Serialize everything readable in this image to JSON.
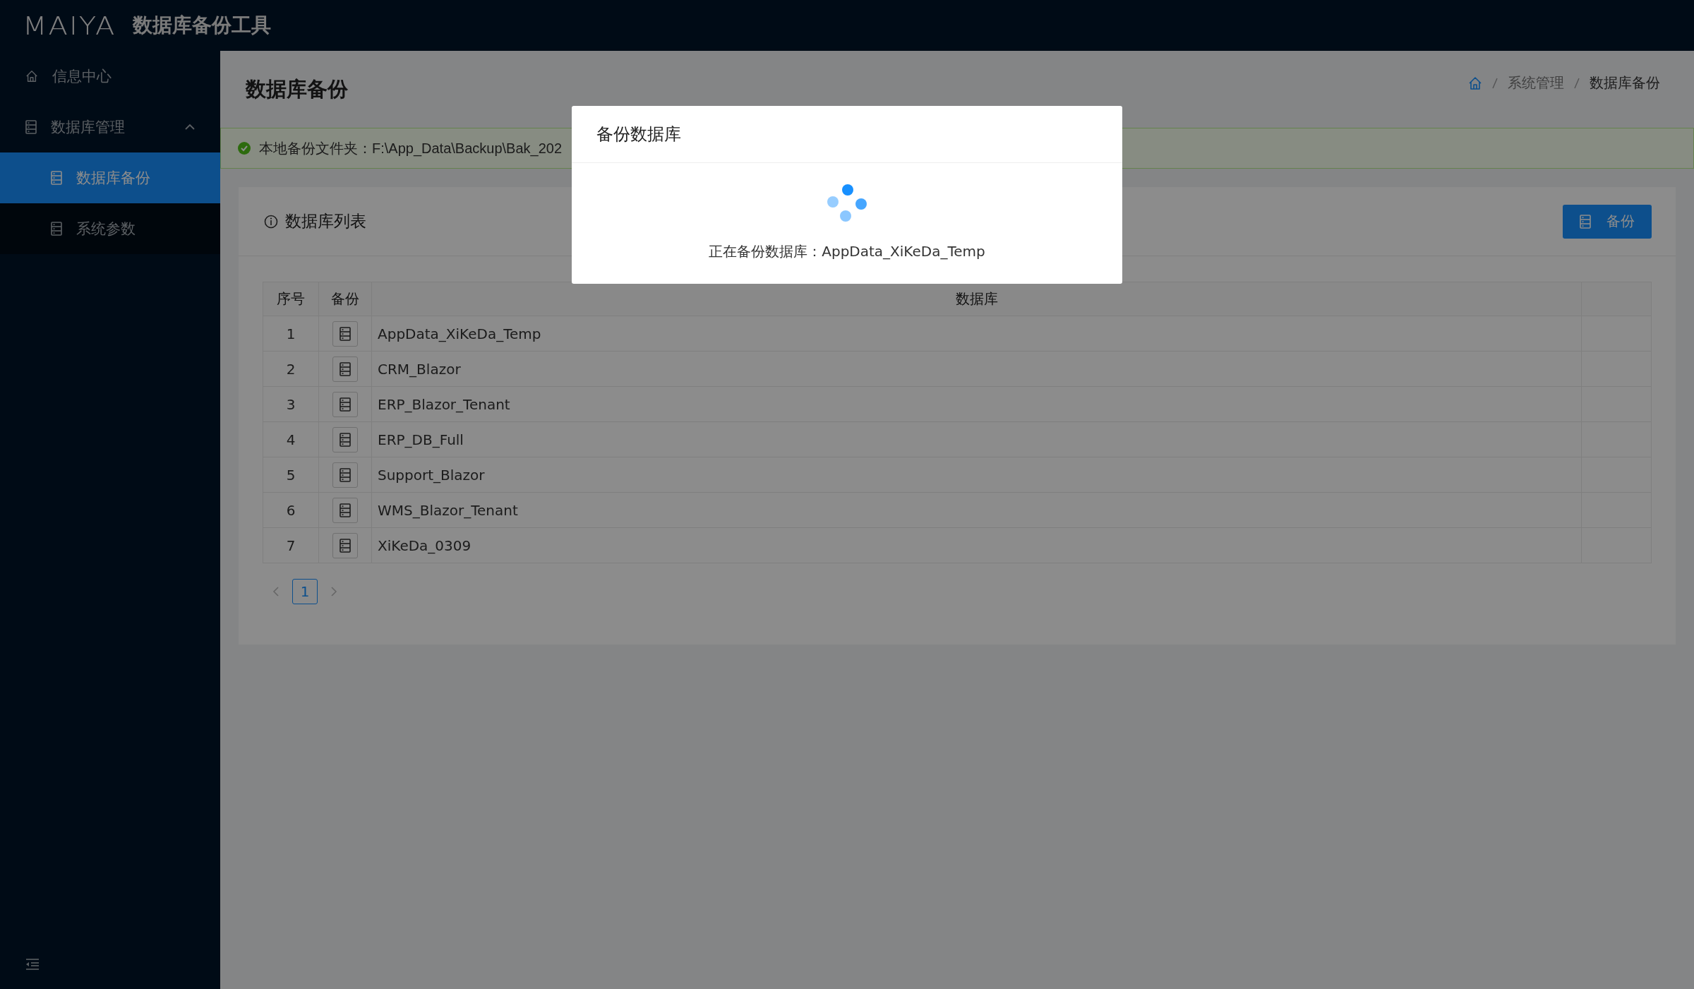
{
  "header": {
    "logo": "MAIYA",
    "title": "数据库备份工具"
  },
  "sidebar": {
    "items": [
      {
        "label": "信息中心",
        "kind": "link",
        "selected": false
      },
      {
        "label": "数据库管理",
        "kind": "group",
        "selected": false,
        "expanded": true,
        "children": [
          {
            "label": "数据库备份",
            "selected": true
          },
          {
            "label": "系统参数",
            "selected": false
          }
        ]
      }
    ]
  },
  "page": {
    "title": "数据库备份",
    "breadcrumb": [
      "系统管理",
      "数据库备份"
    ]
  },
  "alert": {
    "text": "本地备份文件夹：F:\\App_Data\\Backup\\Bak_202"
  },
  "card": {
    "title": "数据库列表",
    "button": "备份"
  },
  "table": {
    "columns": [
      "序号",
      "备份",
      "数据库"
    ],
    "rows": [
      {
        "index": "1",
        "name": "AppData_XiKeDa_Temp"
      },
      {
        "index": "2",
        "name": "CRM_Blazor"
      },
      {
        "index": "3",
        "name": "ERP_Blazor_Tenant"
      },
      {
        "index": "4",
        "name": "ERP_DB_Full"
      },
      {
        "index": "5",
        "name": "Support_Blazor"
      },
      {
        "index": "6",
        "name": "WMS_Blazor_Tenant"
      },
      {
        "index": "7",
        "name": "XiKeDa_0309"
      }
    ]
  },
  "pagination": {
    "pages": [
      {
        "label": "1",
        "selected": true
      }
    ]
  },
  "modal": {
    "title": "备份数据库",
    "message": "正在备份数据库：AppData_XiKeDa_Temp"
  }
}
